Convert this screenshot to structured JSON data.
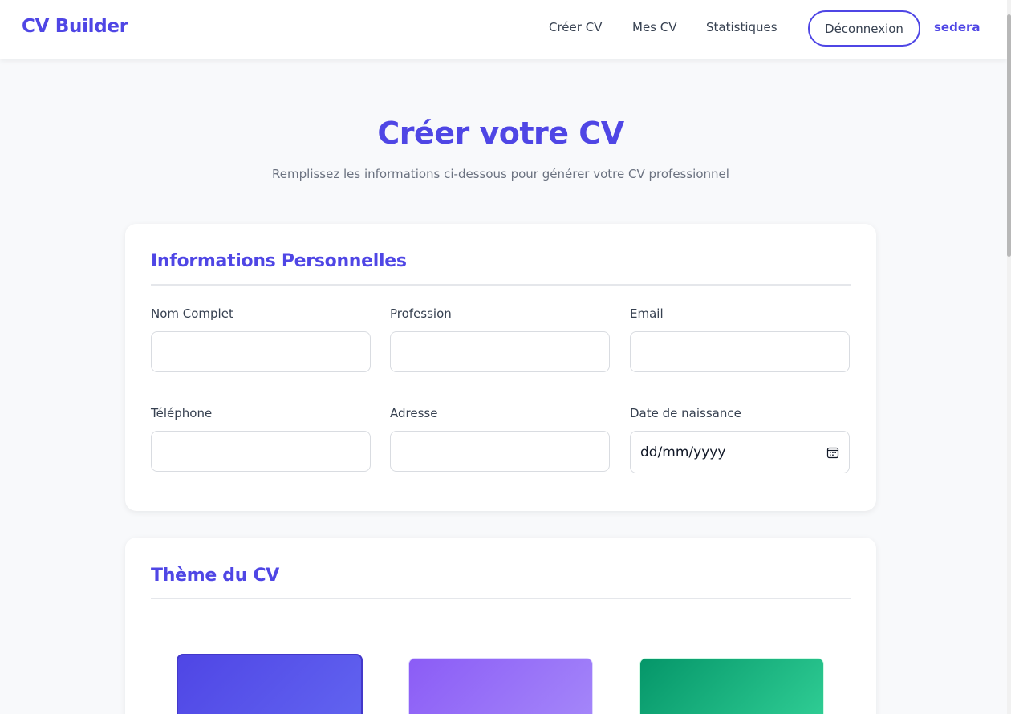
{
  "navbar": {
    "brand": "CV Builder",
    "links": [
      "Créer CV",
      "Mes CV",
      "Statistiques"
    ],
    "logout_label": "Déconnexion",
    "username": "sedera"
  },
  "header": {
    "title": "Créer votre CV",
    "subtitle": "Remplissez les informations ci-dessous pour générer votre CV professionnel"
  },
  "personal_info": {
    "title": "Informations Personnelles",
    "fields": [
      {
        "label": "Nom Complet",
        "value": ""
      },
      {
        "label": "Profession",
        "value": ""
      },
      {
        "label": "Email",
        "value": ""
      },
      {
        "label": "Téléphone",
        "value": ""
      },
      {
        "label": "Adresse",
        "value": ""
      },
      {
        "label": "Date de naissance",
        "value": "dd/mm/yyyy"
      }
    ]
  },
  "theme": {
    "title": "Thème du CV",
    "swatches": [
      {
        "name": "indigo",
        "color": "#4f46e5",
        "selected": true
      },
      {
        "name": "purple",
        "color": "#8b5cf6",
        "selected": false
      },
      {
        "name": "green",
        "color": "#059669",
        "selected": false
      }
    ]
  },
  "colors": {
    "accent": "#4f46e5",
    "background": "#f8f9fb",
    "text": "#374151"
  }
}
